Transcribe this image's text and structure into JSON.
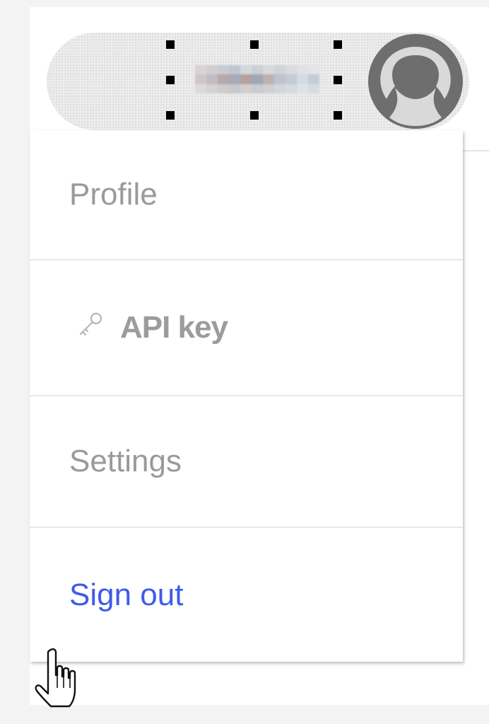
{
  "account": {
    "username_redacted": true,
    "avatar_icon": "user-silhouette-icon",
    "selection_handles": true
  },
  "menu": {
    "items": [
      {
        "label": "Profile",
        "icon": null
      },
      {
        "label": "API key",
        "icon": "key-icon"
      },
      {
        "label": "Settings",
        "icon": null
      },
      {
        "label": "Sign out",
        "icon": null
      }
    ]
  },
  "colors": {
    "signout": "#3f5be8",
    "muted_text": "#9a9a9a",
    "avatar": "#6e6e6e"
  },
  "cursor": "hand-pointer-icon"
}
